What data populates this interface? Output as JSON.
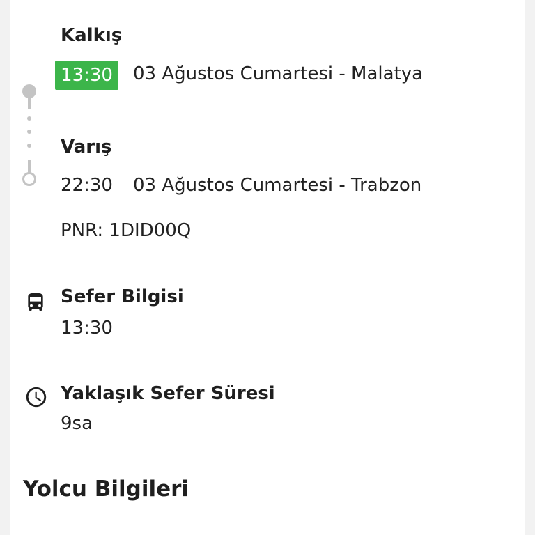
{
  "departure": {
    "label": "Kalkış",
    "time": "13:30",
    "description": "03 Ağustos Cumartesi - Malatya"
  },
  "arrival": {
    "label": "Varış",
    "time": "22:30",
    "description": "03 Ağustos Cumartesi - Trabzon"
  },
  "pnr": "PNR: 1DID00Q",
  "trip_info": {
    "icon": "bus-icon",
    "label": "Sefer Bilgisi",
    "value": "13:30"
  },
  "duration": {
    "icon": "clock-icon",
    "label": "Yaklaşık Sefer Süresi",
    "value": "9sa"
  },
  "passenger_section": {
    "title": "Yolcu Bilgileri"
  },
  "colors": {
    "accent_green": "#3cb54a",
    "timeline_gray": "#c4c4c4"
  }
}
